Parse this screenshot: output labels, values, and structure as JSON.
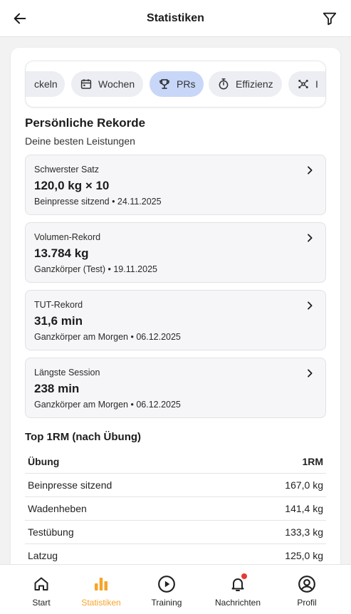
{
  "header": {
    "title": "Statistiken"
  },
  "tabs": [
    {
      "label": "ckeln",
      "icon": "partial-icon",
      "active": false
    },
    {
      "label": "Wochen",
      "icon": "calendar-icon",
      "active": false
    },
    {
      "label": "PRs",
      "icon": "trophy-icon",
      "active": true
    },
    {
      "label": "Effizienz",
      "icon": "stopwatch-icon",
      "active": false
    },
    {
      "label": "I",
      "icon": "network-icon",
      "active": false
    }
  ],
  "records_section": {
    "title": "Persönliche Rekorde",
    "subtitle": "Deine besten Leistungen"
  },
  "records": [
    {
      "label": "Schwerster Satz",
      "value": "120,0 kg × 10",
      "meta": "Beinpresse sitzend • 24.11.2025"
    },
    {
      "label": "Volumen-Rekord",
      "value": "13.784 kg",
      "meta": "Ganzkörper (Test) • 19.11.2025"
    },
    {
      "label": "TUT-Rekord",
      "value": "31,6 min",
      "meta": "Ganzkörper am Morgen • 06.12.2025"
    },
    {
      "label": "Längste Session",
      "value": "238 min",
      "meta": "Ganzkörper am Morgen • 06.12.2025"
    }
  ],
  "top1rm": {
    "title": "Top 1RM (nach Übung)",
    "col_exercise": "Übung",
    "col_value": "1RM",
    "rows": [
      {
        "exercise": "Beinpresse sitzend",
        "value": "167,0 kg"
      },
      {
        "exercise": "Wadenheben",
        "value": "141,4 kg"
      },
      {
        "exercise": "Testübung",
        "value": "133,3 kg"
      },
      {
        "exercise": "Latzug",
        "value": "125,0 kg"
      }
    ]
  },
  "nav": [
    {
      "label": "Start",
      "icon": "home-icon"
    },
    {
      "label": "Statistiken",
      "icon": "bar-chart-icon",
      "active": true
    },
    {
      "label": "Training",
      "icon": "play-circle-icon"
    },
    {
      "label": "Nachrichten",
      "icon": "bell-icon",
      "badge": true
    },
    {
      "label": "Profil",
      "icon": "user-circle-icon"
    }
  ],
  "colors": {
    "accent": "#f5a52a",
    "active_chip": "#c8d6f8",
    "badge": "#e53935"
  }
}
